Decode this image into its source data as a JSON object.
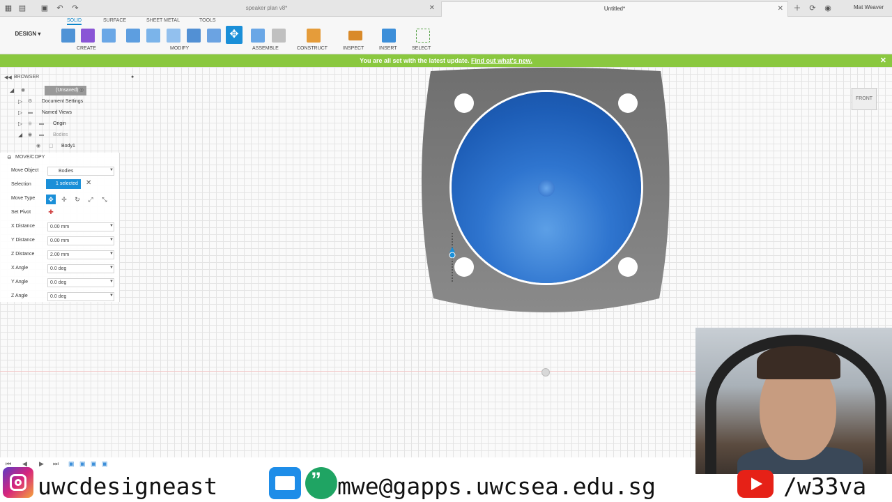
{
  "tabs": [
    {
      "label": "speaker plan v8*",
      "active": false
    },
    {
      "label": "Untitled*",
      "active": true
    }
  ],
  "user": {
    "name": "Mat Weaver"
  },
  "workspace": {
    "label": "DESIGN"
  },
  "mode_tabs": [
    "SOLID",
    "SURFACE",
    "SHEET METAL",
    "TOOLS"
  ],
  "tool_groups": [
    "CREATE",
    "MODIFY",
    "ASSEMBLE",
    "CONSTRUCT",
    "INSPECT",
    "INSERT",
    "SELECT"
  ],
  "banner": {
    "text": "You are all set with the latest update.",
    "link": "Find out what's new."
  },
  "browser": {
    "title": "BROWSER",
    "items": [
      {
        "label": "(Unsaved)"
      },
      {
        "label": "Document Settings"
      },
      {
        "label": "Named Views"
      },
      {
        "label": "Origin"
      },
      {
        "label": "Bodies"
      },
      {
        "label": "Body1"
      }
    ]
  },
  "move_dialog": {
    "title": "MOVE/COPY",
    "move_object_label": "Move Object",
    "move_object_value": "Bodies",
    "selection_label": "Selection",
    "selection_value": "1 selected",
    "move_type_label": "Move Type",
    "set_pivot_label": "Set Pivot",
    "fields": [
      {
        "label": "X Distance",
        "value": "0.00 mm"
      },
      {
        "label": "Y Distance",
        "value": "0.00 mm"
      },
      {
        "label": "Z Distance",
        "value": "2.00 mm"
      },
      {
        "label": "X Angle",
        "value": "0.0 deg"
      },
      {
        "label": "Y Angle",
        "value": "0.0 deg"
      },
      {
        "label": "Z Angle",
        "value": "0.0 deg"
      }
    ]
  },
  "viewcube": {
    "face": "FRONT"
  },
  "social": {
    "instagram": "uwcdesigneast",
    "email": "mwe@gapps.uwcsea.edu.sg",
    "youtube": "/w33va"
  },
  "colors": {
    "accent": "#0a84c9",
    "banner": "#8ac83f",
    "body": "#2f75cf",
    "plate": "#7a7a7a"
  }
}
